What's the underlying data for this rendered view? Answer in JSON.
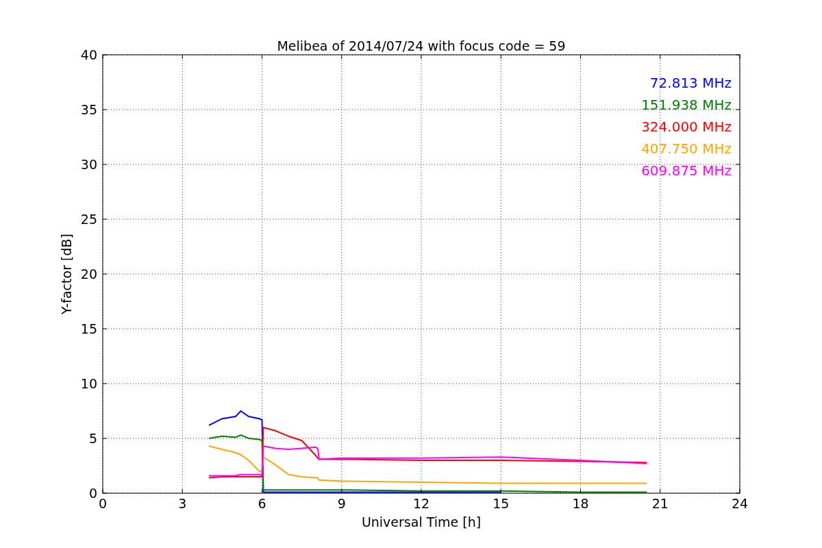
{
  "chart_data": {
    "type": "line",
    "title": "Melibea of 2014/07/24 with focus code = 59",
    "xlabel": "Universal Time [h]",
    "ylabel": "Y-factor [dB]",
    "x": [
      4,
      4.5,
      5,
      5.2,
      5.5,
      5.9,
      6,
      6.05,
      6.5,
      7,
      7.5,
      8,
      8.1,
      8.15,
      9,
      12,
      15,
      18,
      20.5
    ],
    "series": [
      {
        "name": "72.813 MHz",
        "color": "#0000ff",
        "values": [
          6.2,
          6.8,
          7.0,
          7.5,
          7.0,
          6.8,
          6.7,
          0.1,
          0.1,
          0.1,
          0.1,
          0.1,
          0.1,
          0.1,
          0.1,
          0.1,
          0.1,
          null,
          null
        ]
      },
      {
        "name": "151.938 MHz",
        "color": "#008000",
        "values": [
          5.0,
          5.2,
          5.1,
          5.3,
          5.0,
          4.9,
          4.8,
          0.3,
          0.3,
          0.3,
          0.3,
          0.3,
          0.3,
          0.3,
          0.3,
          0.2,
          0.2,
          0.1,
          0.1
        ]
      },
      {
        "name": "324.000 MHz",
        "color": "#ff0000",
        "values": [
          1.4,
          1.5,
          1.5,
          1.5,
          1.5,
          1.5,
          1.5,
          6.0,
          5.7,
          5.2,
          4.8,
          3.5,
          3.2,
          3.1,
          3.1,
          3.0,
          3.0,
          2.9,
          2.8
        ]
      },
      {
        "name": "407.750 MHz",
        "color": "#ffa500",
        "values": [
          4.3,
          4.0,
          3.7,
          3.5,
          3.0,
          2.0,
          2.0,
          3.3,
          2.6,
          1.7,
          1.5,
          1.4,
          1.4,
          1.2,
          1.1,
          1.0,
          0.9,
          0.9,
          0.9
        ]
      },
      {
        "name": "609.875 MHz",
        "color": "#ff00ff",
        "values": [
          1.6,
          1.6,
          1.6,
          1.7,
          1.7,
          1.7,
          1.6,
          4.3,
          4.1,
          4.0,
          4.1,
          4.2,
          4.1,
          3.1,
          3.2,
          3.2,
          3.3,
          3.0,
          2.7
        ]
      }
    ],
    "xlim": [
      0,
      24
    ],
    "ylim": [
      0,
      40
    ],
    "xticks": [
      0,
      3,
      6,
      9,
      12,
      15,
      18,
      21,
      24
    ],
    "yticks": [
      0,
      5,
      10,
      15,
      20,
      25,
      30,
      35,
      40
    ],
    "grid": true
  }
}
